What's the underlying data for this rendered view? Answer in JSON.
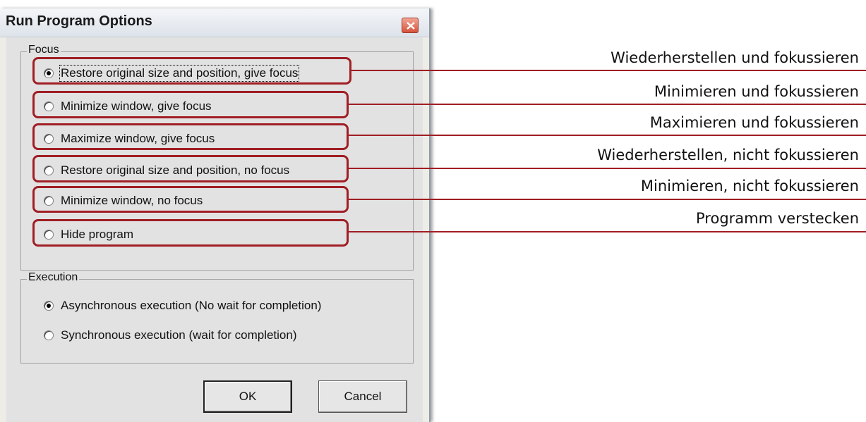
{
  "window": {
    "title": "Run Program Options"
  },
  "focus_group": {
    "legend": "Focus",
    "options": [
      {
        "label": "Restore original size and position, give focus",
        "selected": true
      },
      {
        "label": "Minimize window, give focus",
        "selected": false
      },
      {
        "label": "Maximize window, give focus",
        "selected": false
      },
      {
        "label": "Restore original size and position, no focus",
        "selected": false
      },
      {
        "label": "Minimize window, no focus",
        "selected": false
      },
      {
        "label": "Hide program",
        "selected": false
      }
    ]
  },
  "execution_group": {
    "legend": "Execution",
    "options": [
      {
        "label": "Asynchronous execution (No wait for completion)",
        "selected": true
      },
      {
        "label": "Synchronous execution (wait for completion)",
        "selected": false
      }
    ]
  },
  "buttons": {
    "ok": "OK",
    "cancel": "Cancel"
  },
  "annotations": [
    "Wiederherstellen und fokussieren",
    "Minimieren und fokussieren",
    "Maximieren und fokussieren",
    "Wiederherstellen, nicht fokussieren",
    "Minimieren, nicht fokussieren",
    "Programm verstecken"
  ],
  "colors": {
    "highlight": "#a01e24",
    "close_button": "#d4533c"
  }
}
